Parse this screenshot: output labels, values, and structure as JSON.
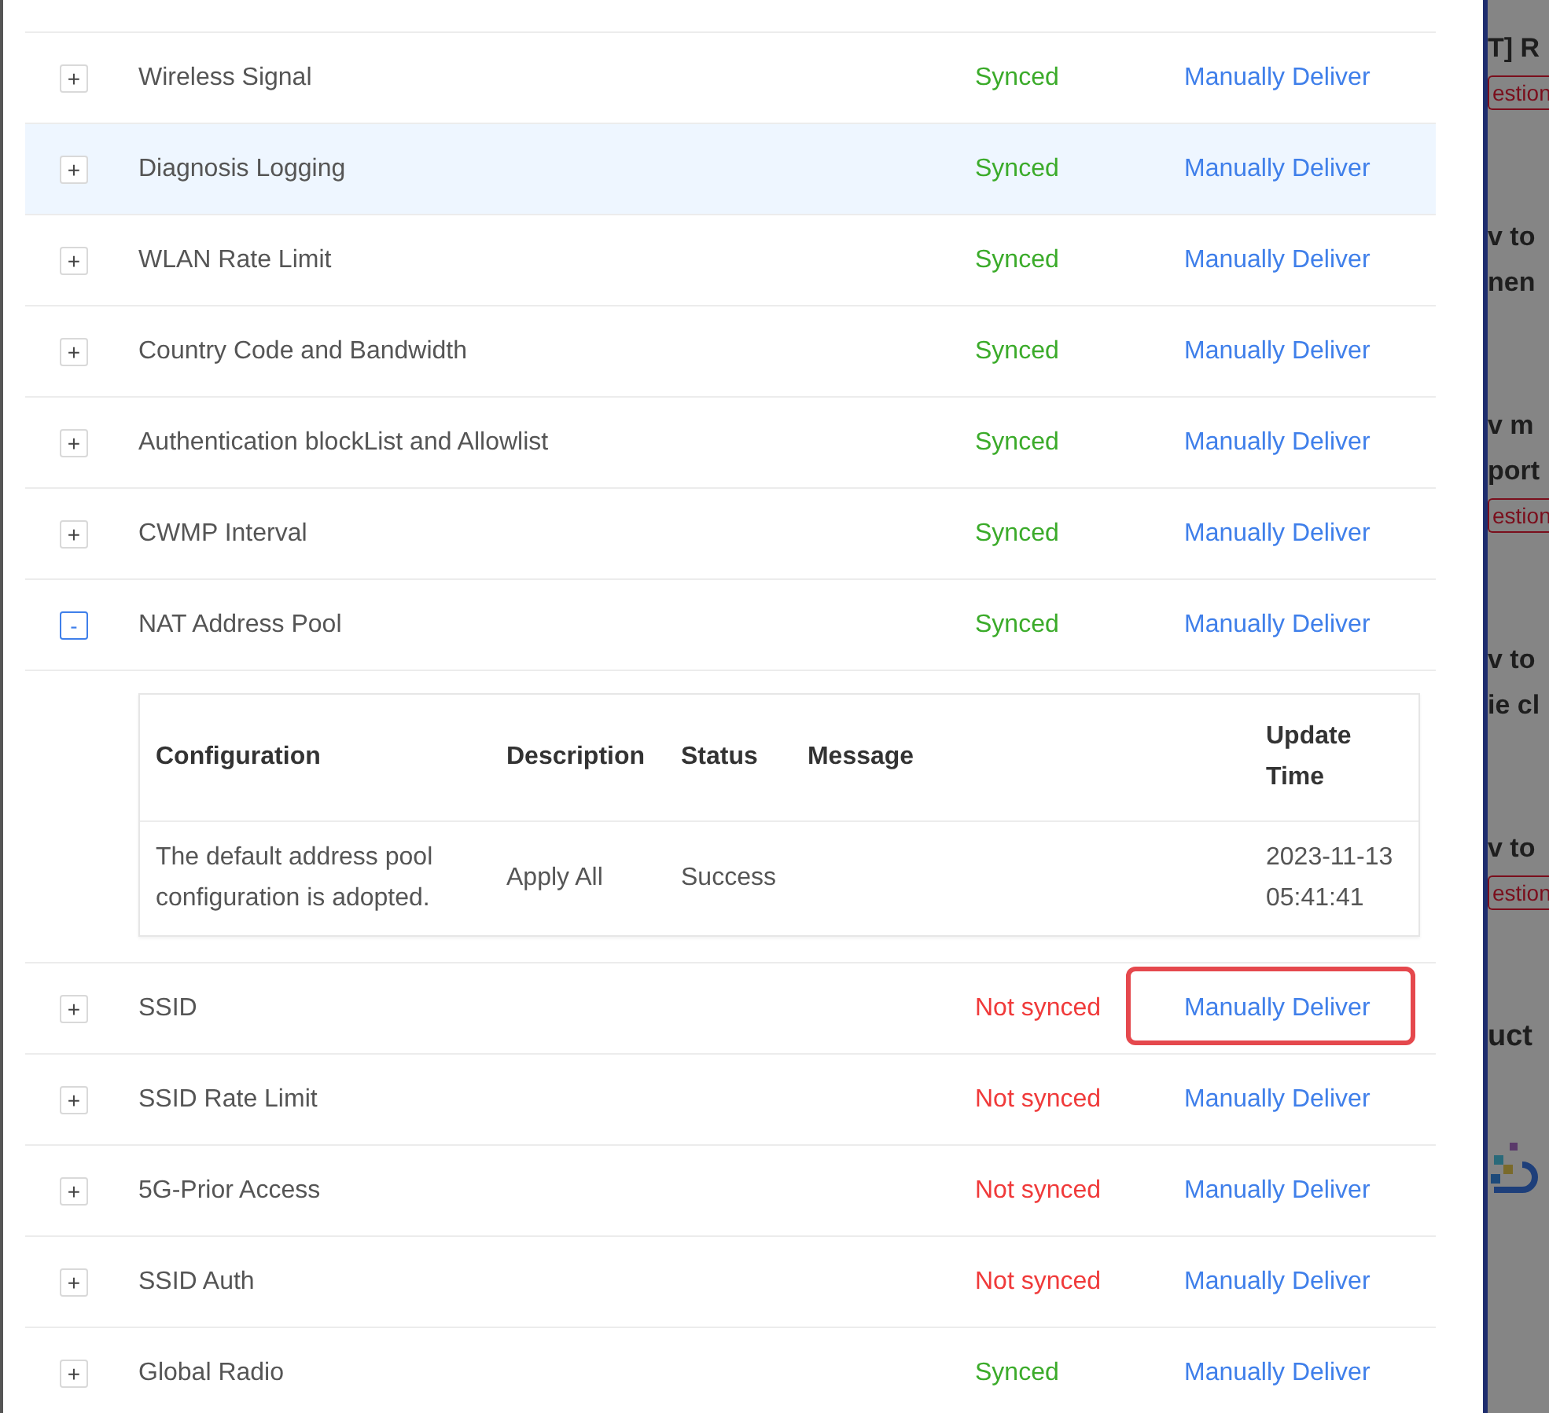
{
  "config_list": {
    "rows": [
      {
        "name": "Wireless Signal",
        "toggle": "+",
        "status": "Synced",
        "synced": true,
        "action": "Manually Deliver",
        "expanded": false,
        "highlighted": false,
        "annotated": false
      },
      {
        "name": "Diagnosis Logging",
        "toggle": "+",
        "status": "Synced",
        "synced": true,
        "action": "Manually Deliver",
        "expanded": false,
        "highlighted": true,
        "annotated": false
      },
      {
        "name": "WLAN Rate Limit",
        "toggle": "+",
        "status": "Synced",
        "synced": true,
        "action": "Manually Deliver",
        "expanded": false,
        "highlighted": false,
        "annotated": false
      },
      {
        "name": "Country Code and Bandwidth",
        "toggle": "+",
        "status": "Synced",
        "synced": true,
        "action": "Manually Deliver",
        "expanded": false,
        "highlighted": false,
        "annotated": false
      },
      {
        "name": "Authentication blockList and Allowlist",
        "toggle": "+",
        "status": "Synced",
        "synced": true,
        "action": "Manually Deliver",
        "expanded": false,
        "highlighted": false,
        "annotated": false
      },
      {
        "name": "CWMP Interval",
        "toggle": "+",
        "status": "Synced",
        "synced": true,
        "action": "Manually Deliver",
        "expanded": false,
        "highlighted": false,
        "annotated": false
      },
      {
        "name": "NAT Address Pool",
        "toggle": "-",
        "status": "Synced",
        "synced": true,
        "action": "Manually Deliver",
        "expanded": true,
        "highlighted": false,
        "annotated": false,
        "details": {
          "columns": [
            "Configuration",
            "Description",
            "Status",
            "Message",
            "Update Time"
          ],
          "rows": [
            [
              "The default address pool configuration is adopted.",
              "Apply All",
              "Success",
              "",
              "2023-11-13 05:41:41"
            ]
          ]
        }
      },
      {
        "name": "SSID",
        "toggle": "+",
        "status": "Not synced",
        "synced": false,
        "action": "Manually Deliver",
        "expanded": false,
        "highlighted": false,
        "annotated": true
      },
      {
        "name": "SSID Rate Limit",
        "toggle": "+",
        "status": "Not synced",
        "synced": false,
        "action": "Manually Deliver",
        "expanded": false,
        "highlighted": false,
        "annotated": false
      },
      {
        "name": "5G-Prior Access",
        "toggle": "+",
        "status": "Not synced",
        "synced": false,
        "action": "Manually Deliver",
        "expanded": false,
        "highlighted": false,
        "annotated": false
      },
      {
        "name": "SSID Auth",
        "toggle": "+",
        "status": "Not synced",
        "synced": false,
        "action": "Manually Deliver",
        "expanded": false,
        "highlighted": false,
        "annotated": false
      },
      {
        "name": "Global Radio",
        "toggle": "+",
        "status": "Synced",
        "synced": true,
        "action": "Manually Deliver",
        "expanded": false,
        "highlighted": false,
        "annotated": false
      }
    ]
  },
  "background_page": {
    "groups": [
      [
        {
          "kind": "title",
          "text": "T] R"
        },
        {
          "kind": "tag",
          "text": "estion"
        }
      ],
      [
        {
          "kind": "title",
          "text": "v to"
        },
        {
          "kind": "title",
          "text": "nen"
        }
      ],
      [
        {
          "kind": "title",
          "text": "v m"
        },
        {
          "kind": "title",
          "text": "port"
        },
        {
          "kind": "tag",
          "text": "estion"
        }
      ],
      [
        {
          "kind": "title",
          "text": "v to"
        },
        {
          "kind": "title",
          "text": "ie cl"
        }
      ],
      [
        {
          "kind": "title",
          "text": "v to"
        },
        {
          "kind": "tag",
          "text": "estion"
        }
      ],
      [
        {
          "kind": "heading",
          "text": "uct"
        },
        {
          "kind": "logo"
        }
      ]
    ]
  }
}
